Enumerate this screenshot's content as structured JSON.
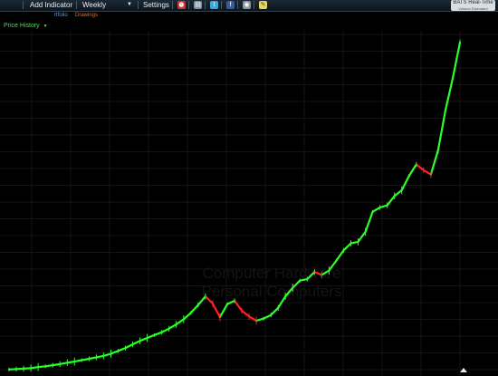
{
  "toolbar": {
    "add_indicator": "Add Indicator",
    "interval": "Weekly",
    "settings": "Settings",
    "realtime_title": "BATS Real-Time",
    "realtime_sub": "Volume Estimated",
    "icons": [
      "alarm-clock-icon",
      "document-icon",
      "twitter-icon",
      "facebook-icon",
      "camera-icon",
      "sticky-note-icon"
    ]
  },
  "subbar": {
    "portfolio": "rtfolio",
    "drawings": "Drawings"
  },
  "chart_header": {
    "label": "Price History"
  },
  "watermark": {
    "line1": "Computer Hardware",
    "line2": "Personal Computers"
  },
  "colors": {
    "up": "#2bff2b",
    "down": "#ff2020",
    "grid": "#151515",
    "background": "#000000"
  },
  "chart_data": {
    "type": "line",
    "series": [
      {
        "values": [
          4,
          4.5,
          5.2,
          6,
          7.5,
          8.5,
          10,
          11.5,
          13.5,
          15,
          17,
          19,
          21,
          23,
          26,
          30,
          34,
          39,
          44,
          48,
          52,
          56,
          61,
          67,
          74,
          83,
          94,
          106,
          96,
          77,
          95,
          100,
          86,
          78,
          72,
          75,
          80,
          90,
          106,
          118,
          128,
          130,
          140,
          136,
          142,
          156,
          170,
          180,
          182,
          196,
          224,
          230,
          233,
          246,
          254,
          274,
          290,
          282,
          276,
          310,
          365,
          410,
          460
        ]
      }
    ],
    "ylim": [
      0,
      470
    ],
    "grid": true
  }
}
